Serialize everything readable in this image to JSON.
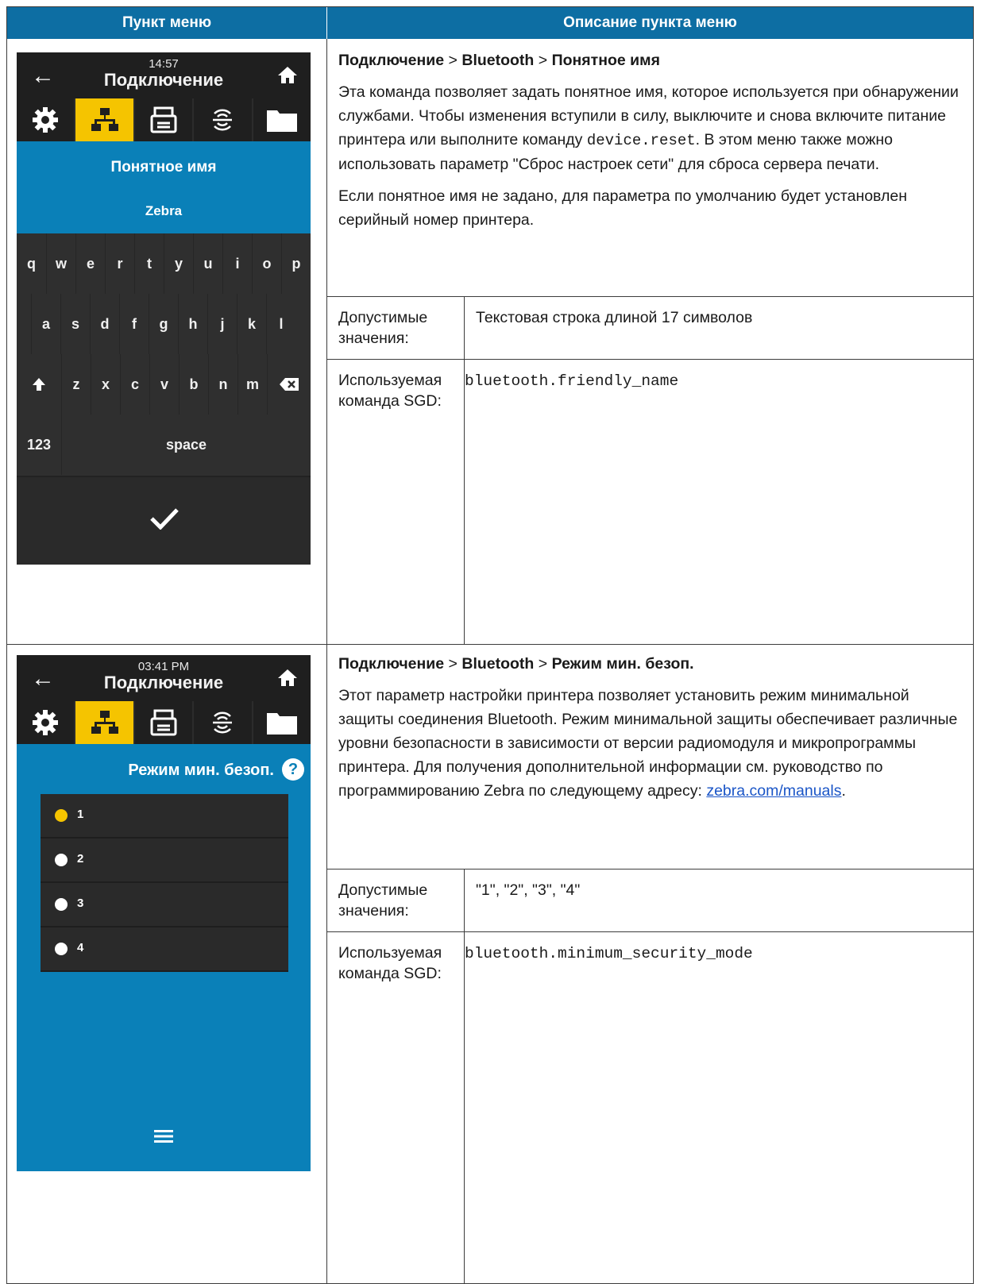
{
  "header": {
    "col1": "Пункт меню",
    "col2": "Описание пункта меню"
  },
  "row1": {
    "screen": {
      "time": "14:57",
      "title": "Подключение",
      "field_title": "Понятное имя",
      "field_value": "Zebra",
      "keys_row1": [
        "q",
        "w",
        "e",
        "r",
        "t",
        "y",
        "u",
        "i",
        "o",
        "p"
      ],
      "keys_row2": [
        "a",
        "s",
        "d",
        "f",
        "g",
        "h",
        "j",
        "k",
        "l"
      ],
      "keys_row3": [
        "z",
        "x",
        "c",
        "v",
        "b",
        "n",
        "m"
      ],
      "key_123": "123",
      "key_space": "space",
      "icons": [
        "settings-icon",
        "network-icon",
        "printer-icon",
        "rfid-icon",
        "folder-icon"
      ]
    },
    "path": {
      "p1": "Подключение",
      "sep1": " > ",
      "p2": "Bluetooth",
      "sep2": " > ",
      "p3": "Понятное имя"
    },
    "desc1_a": "Эта команда позволяет задать понятное имя, которое используется при обнаружении службами. Чтобы изменения вступили в силу, выключите и снова включите питание принтера или выполните команду ",
    "desc1_code": "device.reset",
    "desc1_b": ". В этом меню также можно использовать параметр \"Сброс настроек сети\" для сброса сервера печати.",
    "desc2": "Если понятное имя не задано, для параметра по умолчанию будет установлен серийный номер принтера.",
    "accepted_label": "Допустимые значения:",
    "accepted_value": "Текстовая строка длиной 17 символов",
    "sgd_label": "Используемая команда SGD:",
    "sgd_value": "bluetooth.friendly_name"
  },
  "row2": {
    "screen": {
      "time": "03:41 PM",
      "title": "Подключение",
      "panel_title": "Режим мин. безоп.",
      "options": [
        "1",
        "2",
        "3",
        "4"
      ],
      "selected": "1"
    },
    "path": {
      "p1": "Подключение",
      "sep1": " > ",
      "p2": "Bluetooth",
      "sep2": " > ",
      "p3": "Режим мин. безоп."
    },
    "desc1_a": "Этот параметр настройки принтера позволяет установить режим минимальной защиты соединения Bluetooth. Режим минимальной защиты обеспечивает различные уровни безопасности в зависимости от версии радиомодуля и микропрограммы принтера. Для получения дополнительной информации см. руководство по программированию Zebra по следующему адресу: ",
    "desc1_link": "zebra.com/manuals",
    "desc1_b": ".",
    "accepted_label": "Допустимые значения:",
    "accepted_value": "\"1\", \"2\", \"3\", \"4\"",
    "sgd_label": "Используемая команда SGD:",
    "sgd_value": "bluetooth.minimum_security_mode"
  }
}
